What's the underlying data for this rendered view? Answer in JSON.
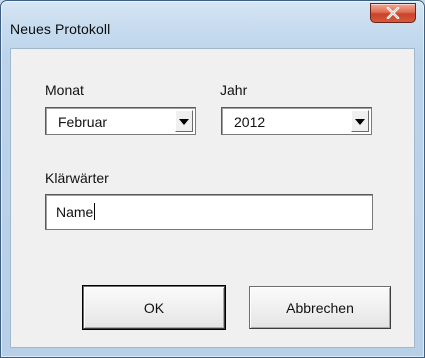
{
  "window": {
    "title": "Neues Protokoll",
    "close_icon": "close-icon"
  },
  "form": {
    "month_label": "Monat",
    "month_value": "Februar",
    "year_label": "Jahr",
    "year_value": "2012",
    "attendant_label": "Klärwärter",
    "attendant_value": "Name"
  },
  "buttons": {
    "ok_label": "OK",
    "cancel_label": "Abbrechen"
  },
  "colors": {
    "close_button": "#d9573c",
    "titlebar": "#c6dbee",
    "client_bg": "#f0f0f0"
  }
}
